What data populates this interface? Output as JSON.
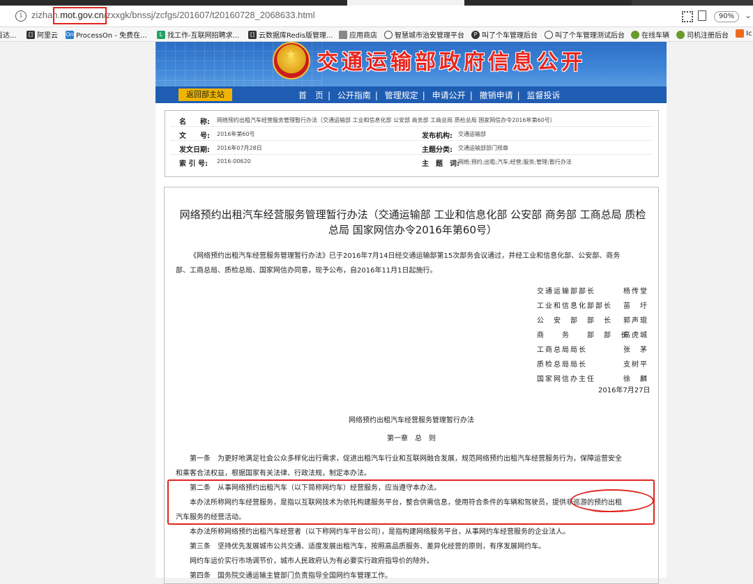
{
  "browser": {
    "url_prefix": "zizhan.",
    "url_domain": "mot.gov.cn",
    "url_rest": "/zxxgk/bnssj/zcfgs/201607/t20160728_2068633.html",
    "zoom": "90%"
  },
  "bookmarks": [
    {
      "label": "百达...",
      "icon": "none"
    },
    {
      "label": "阿里云",
      "icon": "bracket-icon"
    },
    {
      "label": "ProcessOn - 免费在...",
      "icon": "processon-icon"
    },
    {
      "label": "找工作-互联网招聘求...",
      "icon": "l-icon"
    },
    {
      "label": "云数据库Redis版管理...",
      "icon": "bracket-icon"
    },
    {
      "label": "应用商店",
      "icon": "folder-icon"
    },
    {
      "label": "智慧城市治安管理平台",
      "icon": "globe-icon"
    },
    {
      "label": "叫了个车管理后台",
      "icon": "p-icon"
    },
    {
      "label": "叫了个车管理测试后台",
      "icon": "globe-icon"
    },
    {
      "label": "在线车辆",
      "icon": "leaf-icon"
    },
    {
      "label": "司机注册后台",
      "icon": "leaf-icon"
    },
    {
      "label": "Ic",
      "icon": "orange-icon"
    }
  ],
  "site": {
    "banner_title": "交通运输部政府信息公开",
    "home_button": "返回部主站",
    "nav": [
      "首　页",
      "公开指南",
      "管理规定",
      "申请公开",
      "撤销申请",
      "监督投诉"
    ]
  },
  "meta": {
    "name_label": "名　　称:",
    "name_value": "网络预约出租汽车经营服务管理暂行办法（交通运输部 工业和信息化部 公安部 商务部 工商总局 质检总局 国家网信办令2016年第60号）",
    "doc_no_label": "文　　号:",
    "doc_no_value": "2016年第60号",
    "issuer_label": "发布机构:",
    "issuer_value": "交通运输部",
    "date_label": "发文日期:",
    "date_value": "2016年07月28日",
    "category_label": "主题分类:",
    "category_value": "交通运输部部门规章",
    "index_label": "索 引 号:",
    "index_value": "2016-00620",
    "keywords_label": "主　题　词:",
    "keywords_value": "网络;预约;出租;汽车;经营;服务;管理;暂行办法"
  },
  "article": {
    "title_line1": "网络预约出租汽车经营服务管理暂行办法（交通运输部 工业和信息化部 公安部 商务部 工商总局 质检",
    "title_line2": "总局 国家网信办令2016年第60号）",
    "intro_line1": "《网络预约出租汽车经营服务管理暂行办法》已于2016年7月14日经交通运输部第15次部务会议通过，并经工业和信息化部、公安部、商务",
    "intro_line2": "部、工商总局、质检总局、国家网信办同意，现予公布，自2016年11月1日起施行。",
    "signers": [
      {
        "title": "交通运输部部长",
        "name": "杨传堂"
      },
      {
        "title": "工业和信息化部部长",
        "name": "苗　圩"
      },
      {
        "title": "公　安　部　部　长",
        "name": "郭声琨"
      },
      {
        "title": "商　　务　　部　部　长",
        "name": "高虎城"
      },
      {
        "title": "工商总局局长",
        "name": "张　茅"
      },
      {
        "title": "质检总局局长",
        "name": "支树平"
      },
      {
        "title": "国家网信办主任",
        "name": "徐　麟"
      }
    ],
    "sign_date": "2016年7月27日",
    "sub_title": "网络预约出租汽车经营服务管理暂行办法",
    "chapter": "第一章　总　则",
    "art1_line1": "第一条　为更好地满足社会公众多样化出行需求，促进出租汽车行业和互联网融合发展，规范网络预约出租汽车经营服务行为，保障运营安全",
    "art1_line2": "和乘客合法权益，根据国家有关法律、行政法规，制定本办法。",
    "art2_line1": "第二条　从事网络预约出租汽车（以下简称网约车）经营服务，应当遵守本办法。",
    "art2_line2": "本办法所称网约车经营服务，是指以互联网技术为依托构建服务平台，整合供需信息，使用符合条件的车辆和驾驶员，提供非巡游的预约出租",
    "art2_line3": "汽车服务的经营活动。",
    "art2_line4": "本办法所称网络预约出租汽车经营者（以下称网约车平台公司），是指构建网络服务平台，从事网约车经营服务的企业法人。",
    "art3_line1": "第三条　坚持优先发展城市公共交通、适度发展出租汽车，按照高品质服务、差异化经营的原则，有序发展网约车。",
    "art3_line2": "网约车运价实行市场调节价，城市人民政府认为有必要实行政府指导价的除外。",
    "art4_line1": "第四条　国务院交通运输主管部门负责指导全国网约车管理工作。"
  }
}
